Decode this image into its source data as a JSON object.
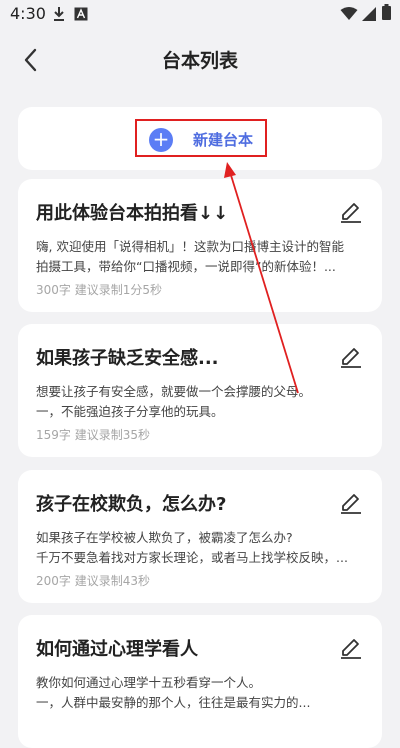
{
  "status_bar": {
    "time": "4:30",
    "icons": [
      "download-icon",
      "a-icon",
      "wifi-icon",
      "signal-icon",
      "battery-icon"
    ]
  },
  "nav": {
    "title": "台本列表",
    "back_icon": "chevron-left-icon"
  },
  "new_script": {
    "label": "新建台本",
    "icon": "plus-icon",
    "accent": "#5b7df5"
  },
  "scripts": [
    {
      "title": "用此体验台本拍拍看↓↓",
      "lines": [
        "嗨, 欢迎使用「说得相机」！这款为口播博主设计的智能",
        "拍摄工具，带给你“口播视频，一说即得”的新体验！..."
      ],
      "meta": "300字  建议录制1分5秒"
    },
    {
      "title": "如果孩子缺乏安全感...",
      "lines": [
        "想要让孩子有安全感，就要做一个会撑腰的父母。",
        "一，不能强迫孩子分享他的玩具。"
      ],
      "meta": "159字  建议录制35秒"
    },
    {
      "title": "孩子在校欺负，怎么办?",
      "lines": [
        "如果孩子在学校被人欺负了，被霸凌了怎么办?",
        "千万不要急着找对方家长理论，或者马上找学校反映，..."
      ],
      "meta": "200字  建议录制43秒"
    },
    {
      "title": "如何通过心理学看人",
      "lines": [
        "教你如何通过心理学十五秒看穿一个人。",
        "一，人群中最安静的那个人，往往是最有实力的..."
      ],
      "meta": ""
    }
  ],
  "annotation_color": "#e02020"
}
